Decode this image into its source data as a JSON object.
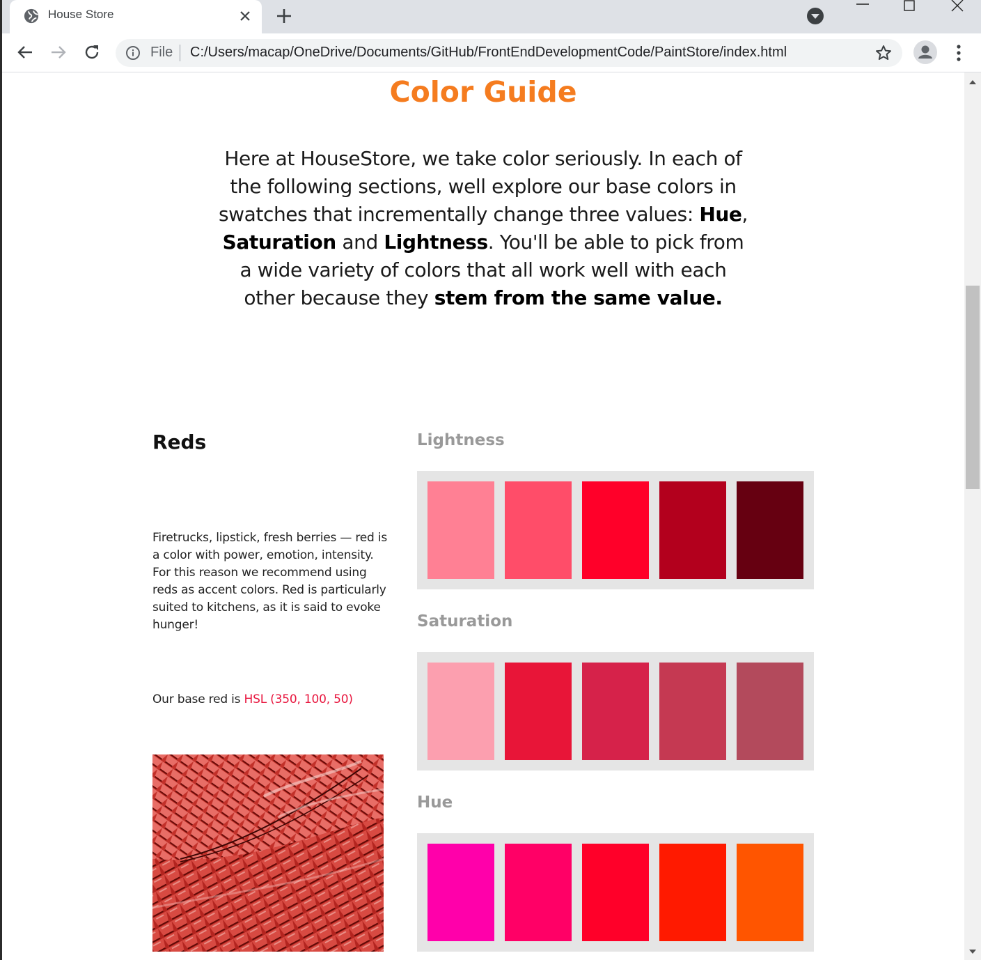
{
  "browser": {
    "tab_title": "House Store",
    "omnibox_scheme": "File",
    "url": "C:/Users/macap/OneDrive/Documents/GitHub/FrontEndDevelopmentCode/PaintStore/index.html"
  },
  "page": {
    "title": "Color Guide",
    "intro": {
      "p1": "Here at HouseStore, we take color seriously. In each of the following sections, well explore our base colors in swatches that incrementally change three values: ",
      "hue": "Hue",
      "comma": ",",
      "saturation": "Saturation",
      "and": " and ",
      "lightness": "Lightness",
      "p2": ". You'll be able to pick from a wide variety of colors that all work well with each other because they ",
      "emphasis": "stem from the same value."
    },
    "reds": {
      "heading": "Reds",
      "description": "Firetrucks, lipstick, fresh berries — red is a color with power, emotion, intensity. For this reason we recommend using reds as accent colors. Red is particularly suited to kitchens, as it is said to evoke hunger!",
      "base_prefix": "Our base red is ",
      "base_value": "HSL (350, 100, 50)",
      "base_value_color": "#e8173f"
    },
    "swatch_groups": [
      {
        "label": "Lightness",
        "colors": [
          "#ff8094",
          "#ff4d69",
          "#ff0029",
          "#b3001d",
          "#660011"
        ]
      },
      {
        "label": "Saturation",
        "colors": [
          "#fc9faf",
          "#e81538",
          "#d6224a",
          "#c53952",
          "#b34a5c"
        ]
      },
      {
        "label": "Hue",
        "colors": [
          "#ff00aa",
          "#ff0066",
          "#ff0029",
          "#ff1a00",
          "#ff5500"
        ]
      }
    ]
  },
  "colors": {
    "accent_title": "#f57c1f",
    "swatch_label": "#999999",
    "swatch_bg": "#e5e5e5"
  }
}
